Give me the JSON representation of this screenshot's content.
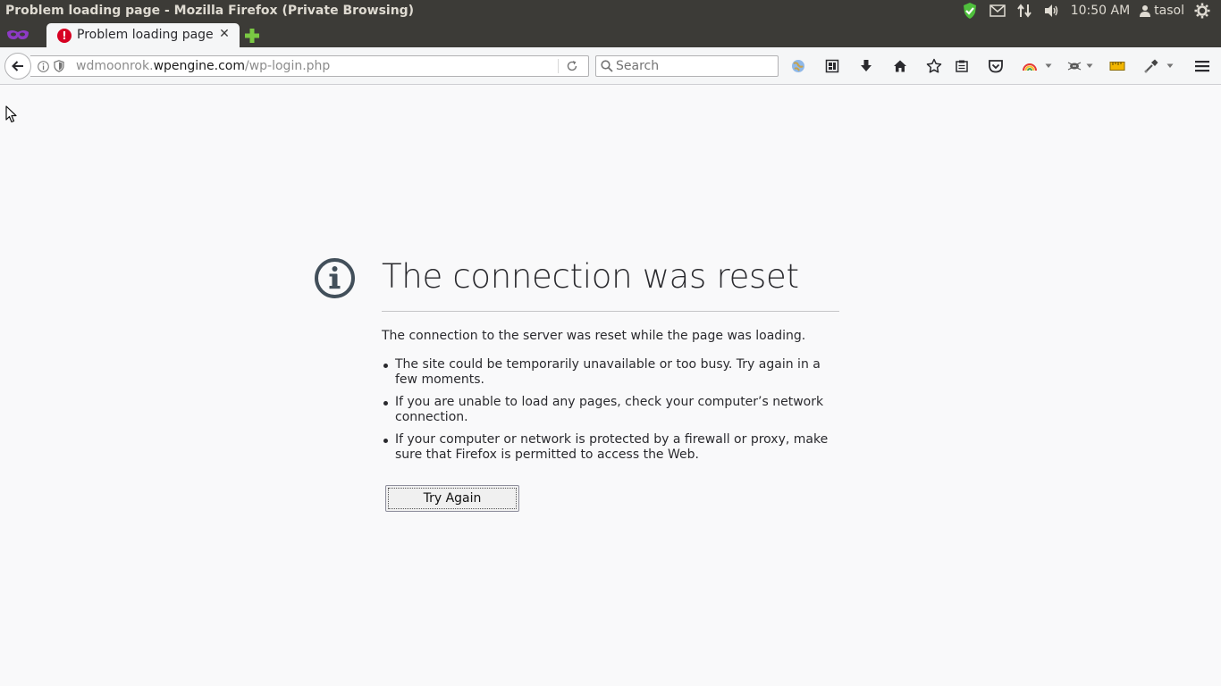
{
  "window": {
    "title": "Problem loading page - Mozilla Firefox (Private Browsing)"
  },
  "panel": {
    "time": "10:50 AM",
    "user": "tasol"
  },
  "tab": {
    "label": "Problem loading page"
  },
  "url": {
    "prefix": "wdmoonrok.",
    "host": "wpengine.com",
    "path": "/wp-login.php"
  },
  "search": {
    "placeholder": "Search"
  },
  "error": {
    "title": "The connection was reset",
    "description": "The connection to the server was reset while the page was loading.",
    "items": [
      "The site could be temporarily unavailable or too busy. Try again in a few moments.",
      "If you are unable to load any pages, check your computer’s network connection.",
      "If your computer or network is protected by a firewall or proxy, make sure that Firefox is permitted to access the Web."
    ],
    "button": "Try Again"
  },
  "colors": {
    "panel": "#3c3b37",
    "toolbar": "#f5f6f7",
    "page": "#f9f9fa",
    "error_red": "#d70022",
    "text": "#2a2a2e"
  }
}
